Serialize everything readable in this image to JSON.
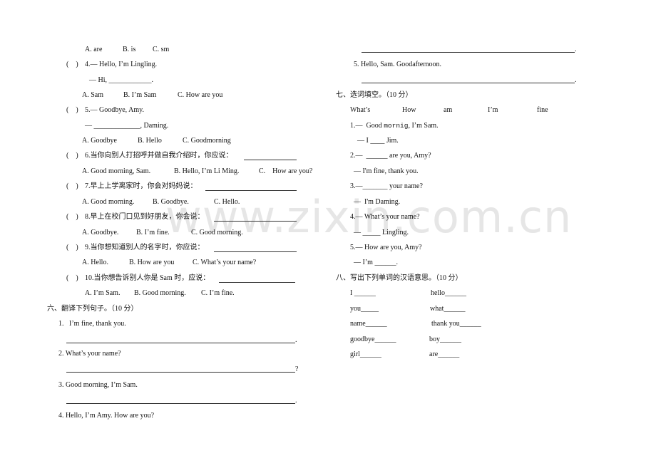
{
  "left": {
    "q3_options": [
      "A. are",
      "B. is",
      "C. sm"
    ],
    "q4": {
      "paren": "(    )",
      "stem": "4.— Hello, I’m Lingling.",
      "reply": "— Hi, ____________.",
      "options": [
        "A. Sam",
        "B. I’m Sam",
        "C. How are you"
      ]
    },
    "q5": {
      "paren": "(    )",
      "stem": "5.— Goodbye, Amy.",
      "reply": "— _____________, Daming.",
      "options": [
        "A. Goodbye",
        "B. Hello",
        "C. Goodmorning"
      ]
    },
    "q6": {
      "paren": "(    )",
      "stem": "6.当你向别人打招呼并做自我介绍时，你应说：",
      "options": [
        "A. Good morning, Sam.",
        "B. Hello, I’m Li Ming.",
        "C.    How are you?"
      ]
    },
    "q7": {
      "paren": "(    )",
      "stem": "7.早上上学离家时，你会对妈妈说：",
      "options": [
        "A. Good morning.",
        "B. Goodbye.",
        "C. Hello."
      ]
    },
    "q8": {
      "paren": "(    )",
      "stem": "8.早上在校门口见到好朋友，你会说：",
      "options": [
        "A. Goodbye.",
        "B. I’m fine.",
        "C. Good morning."
      ]
    },
    "q9": {
      "paren": "(    )",
      "stem": "9.当你想知道别人的名字时，你应说：",
      "options": [
        "A. Hello.",
        "B. How are you",
        "C. What’s your name?"
      ]
    },
    "q10": {
      "paren": "(    )",
      "stem": "10.当你想告诉别人你是 Sam 时，应说：",
      "options": [
        "A. I’m Sam.",
        "B. Good morning.",
        "C. I’m fine."
      ]
    },
    "section6": {
      "title": "六、翻译下列句子。（10 分）",
      "items": [
        {
          "text": "1.   I’m fine, thank you.",
          "end": "."
        },
        {
          "text": "2. What’s your name?",
          "end": "?"
        },
        {
          "text": "3. Good morning, I’m Sam.",
          "end": "."
        },
        {
          "text": "4. Hello, I’m Amy. How are you?"
        }
      ]
    }
  },
  "right": {
    "top_line_end": ".",
    "s6_item5": {
      "text": "5. Hello, Sam. Goodafternoon.",
      "end": "."
    },
    "section7": {
      "title": "七、选词填空。（10 分）",
      "word_bank": [
        "What’s",
        "How",
        "am",
        "I’m",
        "fine"
      ],
      "items": [
        {
          "q_pre": "1.—  Good ",
          "q_mono": "mornig",
          "q_post": ", I’m Sam.",
          "a": "— I ____ Jim."
        },
        {
          "q": "2.—  ______ are you, Amy?",
          "a": "— I'm fine, thank you."
        },
        {
          "q": "3.—_______ your name?",
          "a": "—  I'm Daming."
        },
        {
          "q": "4.— What’s your name?",
          "a": "— _____ Lingling."
        },
        {
          "q": "5.— How are you, Amy?",
          "a": "— I’m ______."
        }
      ]
    },
    "section8": {
      "title": "八、写出下列单词的汉语意思。（10 分）",
      "rows": [
        [
          "I ______",
          "hello______"
        ],
        [
          "you_____",
          "what______"
        ],
        [
          "name______",
          "thank you______"
        ],
        [
          "goodbye______",
          "boy______"
        ],
        [
          "girl______",
          "are______"
        ]
      ]
    }
  },
  "watermark": "www.zixin.com.cn"
}
